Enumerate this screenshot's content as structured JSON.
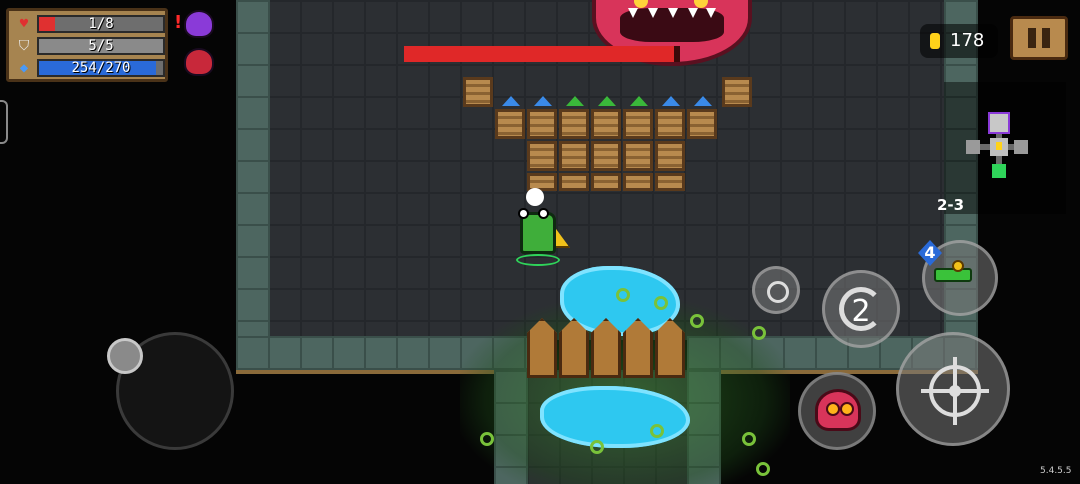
{
  "hud": {
    "health": {
      "label": "1/8",
      "current": 1,
      "max": 8,
      "color": "#e03030",
      "icon": "heart-icon"
    },
    "armor": {
      "label": "5/5",
      "current": 5,
      "max": 5,
      "color": "#8a8a8a",
      "icon": "shield-icon"
    },
    "energy": {
      "label": "254/270",
      "current": 254,
      "max": 270,
      "color": "#2a6ad8",
      "icon": "energy-gem-icon"
    },
    "buff_alert": "!",
    "buffs": [
      {
        "icon": "purple-demon-buff-icon",
        "color": "#8a3ad8"
      },
      {
        "icon": "red-demon-buff-icon",
        "color": "#c8283a"
      }
    ]
  },
  "gold": {
    "value": "178",
    "icon": "gold-coin-icon"
  },
  "pause": {
    "icon": "pause-icon"
  },
  "minimap": {
    "level": "2-3"
  },
  "boss": {
    "health_fraction": 0.98,
    "bar_color": "#e02828"
  },
  "controls": {
    "skill_charges": "2",
    "weapon_energy_cost": "4",
    "weapon_icon": "water-gun-icon",
    "emote_icon": "smiley-icon",
    "attack_icon": "crosshair-icon",
    "pet_icon": "red-monster-pet-icon"
  },
  "version": "5.4.5.5"
}
